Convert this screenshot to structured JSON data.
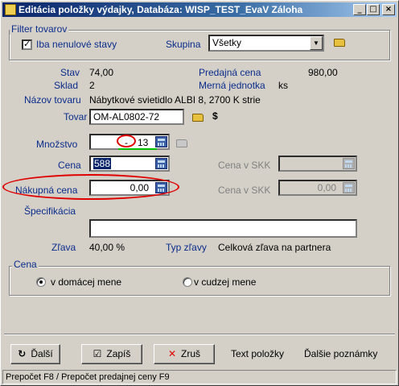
{
  "window": {
    "title": "Editácia položky výdajky, Databáza: WISP_TEST_EvaV Záloha",
    "min_label": "_",
    "max_label": "□",
    "close_label": "×"
  },
  "filter": {
    "group_title": "Filter tovarov",
    "checkbox_label": "Iba nenulové stavy",
    "checked": true,
    "skupina_label": "Skupina",
    "skupina_value": "Všetky"
  },
  "info": {
    "stav_label": "Stav",
    "stav_value": "74,00",
    "predajna_cena_label": "Predajná cena",
    "predajna_cena_value": "980,00",
    "sklad_label": "Sklad",
    "sklad_value": "2",
    "merna_jednotka_label": "Merná jednotka",
    "merna_jednotka_value": "ks",
    "nazov_label": "Názov tovaru",
    "nazov_value": "Nábytkové svietidlo ALBI 8, 2700 K strie"
  },
  "form": {
    "tovar_label": "Tovar",
    "tovar_value": "OM-AL0802-72",
    "currency_symbol": "$",
    "mnozstvo_label": "Množstvo",
    "mnozstvo_sign": "-",
    "mnozstvo_value": "13",
    "cena_label": "Cena",
    "cena_value": "588",
    "cena_skk_label": "Cena v SKK",
    "cena_skk_value": "",
    "nakupna_cena_label": "Nákupná cena",
    "nakupna_cena_value": "0,00",
    "cena_skk2_label": "Cena v SKK",
    "cena_skk2_value": "0,00",
    "specifikacia_label": "Špecifikácia",
    "specifikacia_value": "",
    "zlava_label": "Zľava",
    "zlava_value": "40,00 %",
    "typ_zlavy_label": "Typ zľavy",
    "typ_zlavy_value": "Celková zľava na partnera"
  },
  "cena_group": {
    "title": "Cena",
    "option_domestic": "v domácej mene",
    "option_foreign": "v cudzej mene",
    "selected": "domestic"
  },
  "buttons": {
    "dalsi": "Ďalší",
    "zapis": "Zapíš",
    "zrus": "Zruš",
    "text_polozky": "Text položky",
    "dalsie_poznamky": "Ďalšie poznámky"
  },
  "status": "Prepočet F8 / Prepočet predajnej ceny  F9",
  "colors": {
    "label_blue": "#0a2c8c",
    "annotation_red": "#e00000",
    "annotation_green": "#00c000",
    "title_bar": "#0a246a"
  }
}
